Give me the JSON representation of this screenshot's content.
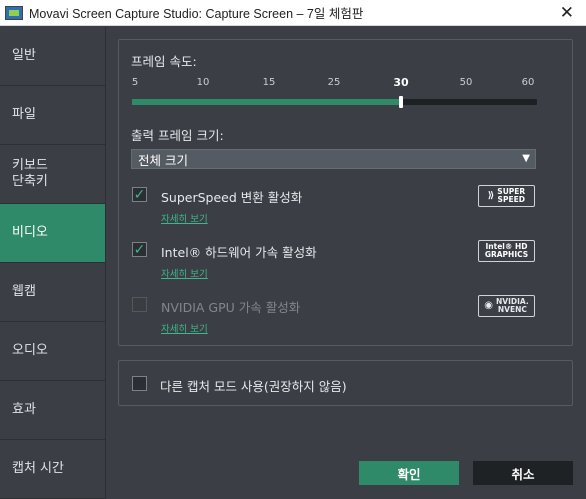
{
  "window": {
    "title": "Movavi Screen Capture Studio: Capture Screen – 7일 체험판",
    "close_glyph": "✕"
  },
  "sidebar": {
    "items": [
      {
        "label": "일반"
      },
      {
        "label": "파일"
      },
      {
        "label": "키보드\n단축키"
      },
      {
        "label": "비디오",
        "active": true
      },
      {
        "label": "웹캠"
      },
      {
        "label": "오디오"
      },
      {
        "label": "효과"
      },
      {
        "label": "캡처 시간"
      }
    ]
  },
  "video": {
    "frame_rate_label": "프레임 속도:",
    "frame_rate_ticks": [
      "5",
      "10",
      "15",
      "25",
      "30",
      "50",
      "60"
    ],
    "frame_rate_value": "30",
    "output_size_label": "출력 프레임 크기:",
    "output_size_value": "전체 크기",
    "options": [
      {
        "label": "SuperSpeed 변환 활성화",
        "checked": true,
        "enabled": true,
        "details": "자세히 보기",
        "badge_icon": "superspeed-logo",
        "badge_text": "SUPER\nSPEED"
      },
      {
        "label": "Intel® 하드웨어 가속 활성화",
        "checked": true,
        "enabled": true,
        "details": "자세히 보기",
        "badge_icon": "intel-hd-graphics-logo",
        "badge_text": "Intel® HD\nGRAPHICS"
      },
      {
        "label": "NVIDIA GPU 가속 활성화",
        "checked": false,
        "enabled": false,
        "details": "자세히 보기",
        "badge_icon": "nvidia-nvenc-logo",
        "badge_text": "NVIDIA.\nNVENC"
      }
    ],
    "other_capture_mode_label": "다른 캡처 모드 사용(권장하지 않음)",
    "other_capture_mode_checked": false
  },
  "buttons": {
    "ok": "확인",
    "cancel": "취소"
  },
  "colors": {
    "accent": "#2e8a68",
    "background": "#3b3f45",
    "link": "#3fb58a"
  }
}
